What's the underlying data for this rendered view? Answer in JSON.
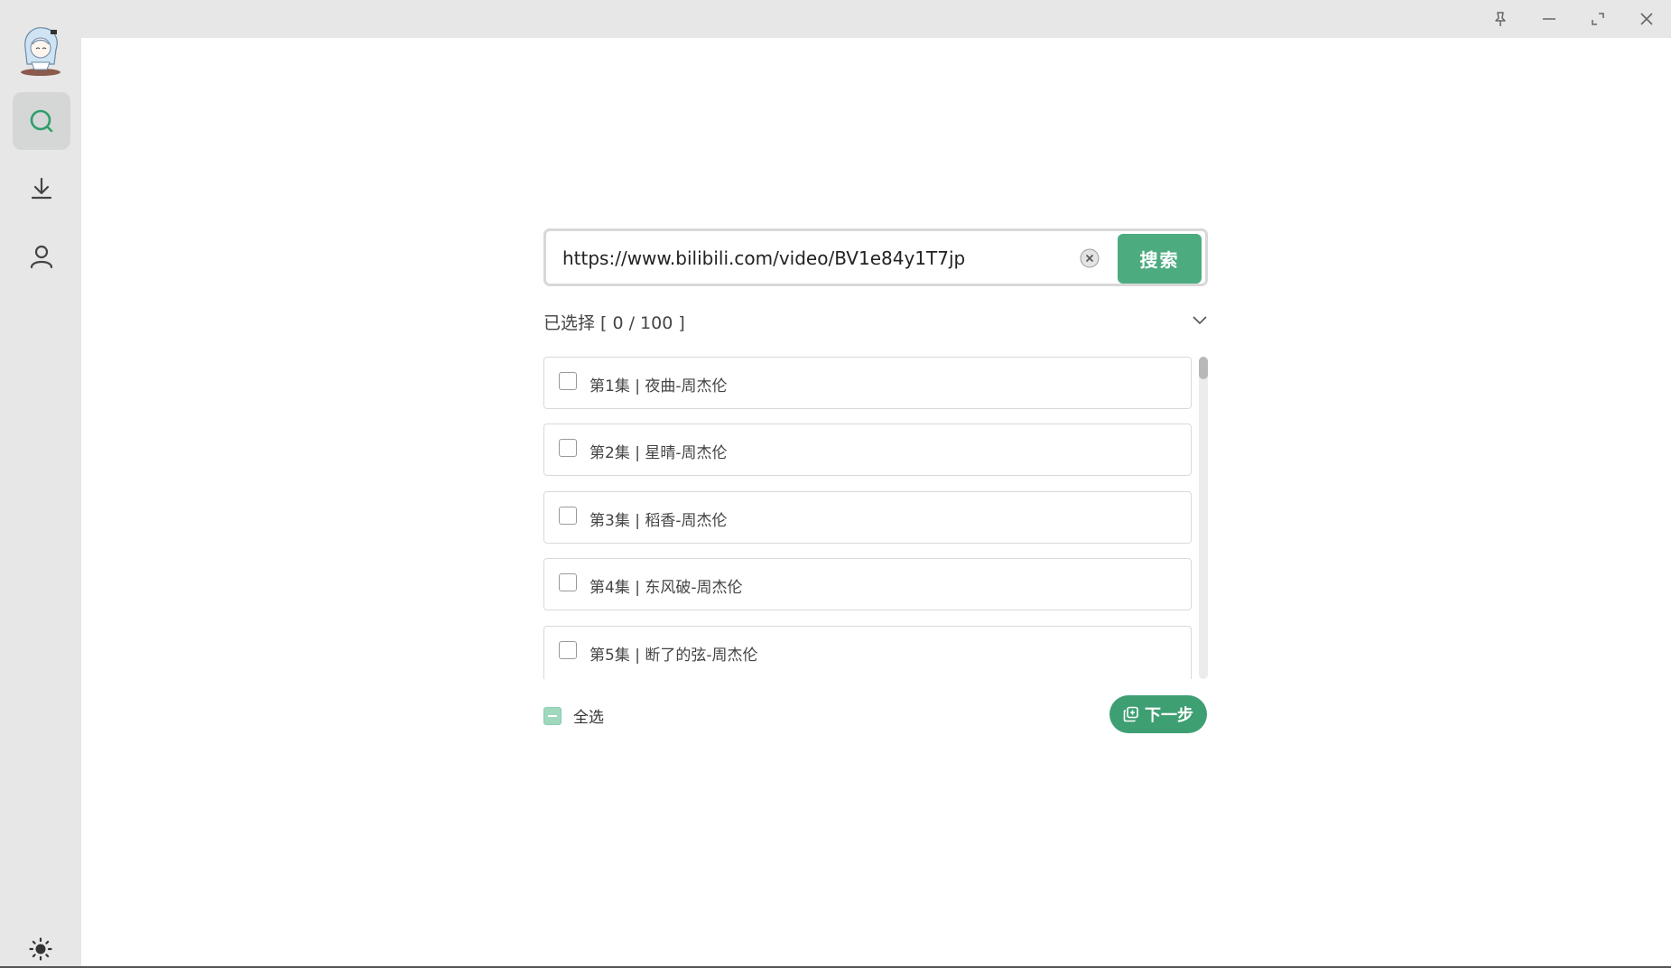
{
  "sidebar": {
    "nav": [
      {
        "name": "search",
        "icon": "search-icon",
        "active": true
      },
      {
        "name": "download",
        "icon": "download-icon",
        "active": false
      },
      {
        "name": "user",
        "icon": "user-icon",
        "active": false
      }
    ],
    "theme_icon": "sun-icon"
  },
  "window_controls": [
    "pin-icon",
    "minimize-icon",
    "maximize-icon",
    "close-icon"
  ],
  "search": {
    "value": "https://www.bilibili.com/video/BV1e84y1T7jp",
    "button_label": "搜索"
  },
  "selection": {
    "label": "已选择 [ 0 / 100 ]"
  },
  "episodes": [
    {
      "label": "第1集 | 夜曲-周杰伦",
      "checked": false
    },
    {
      "label": "第2集 | 星晴-周杰伦",
      "checked": false
    },
    {
      "label": "第3集 | 稻香-周杰伦",
      "checked": false
    },
    {
      "label": "第4集 | 东风破-周杰伦",
      "checked": false
    },
    {
      "label": "第5集 | 断了的弦-周杰伦",
      "checked": false
    }
  ],
  "footer": {
    "select_all_label": "全选",
    "next_label": "下一步"
  },
  "colors": {
    "accent": "#4dab80",
    "accent_dark": "#3e9f73",
    "sidebar_bg": "#e7e7e7"
  }
}
